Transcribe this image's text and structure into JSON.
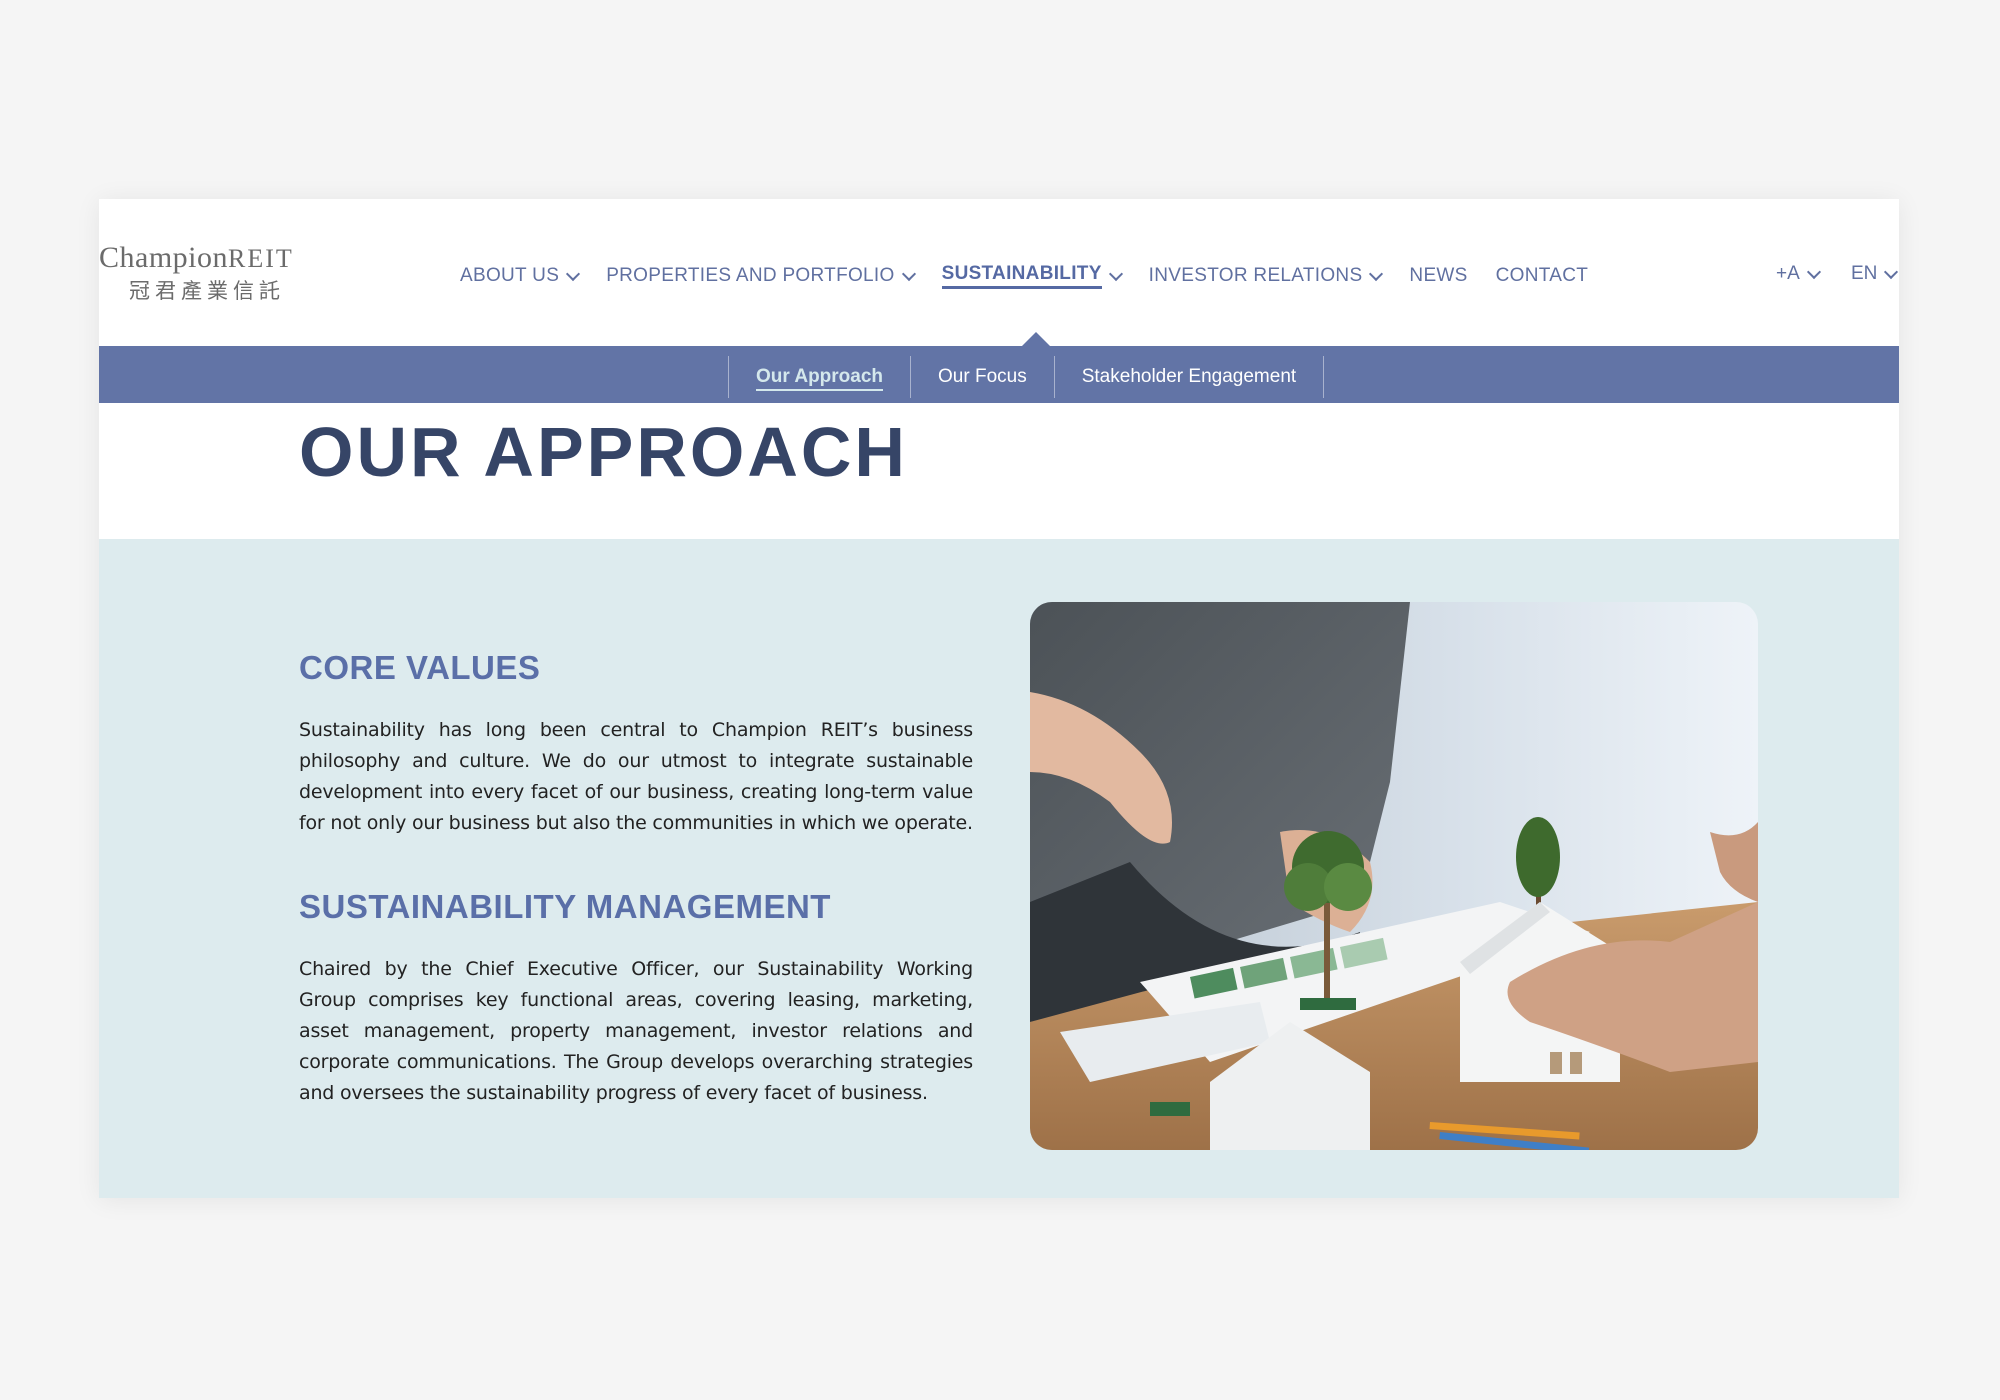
{
  "logo": {
    "name_en": "Champion",
    "name_en_suffix": "REIT",
    "name_zh": "冠君產業信託"
  },
  "nav": {
    "items": [
      {
        "label": "ABOUT US"
      },
      {
        "label": "PROPERTIES AND PORTFOLIO"
      },
      {
        "label": "SUSTAINABILITY"
      },
      {
        "label": "INVESTOR RELATIONS"
      },
      {
        "label": "NEWS"
      },
      {
        "label": "CONTACT"
      }
    ],
    "active": "SUSTAINABILITY"
  },
  "utility": {
    "font_size_label": "+A",
    "language_label": "EN"
  },
  "subnav": {
    "items": [
      {
        "label": "Our Approach"
      },
      {
        "label": "Our Focus"
      },
      {
        "label": "Stakeholder Engagement"
      }
    ],
    "active": "Our Approach"
  },
  "page": {
    "title": "OUR APPROACH"
  },
  "sections": [
    {
      "heading": "CORE VALUES",
      "body": "Sustainability has long been central to Champion REIT’s business philosophy and culture. We do our utmost to integrate sustainable development into every facet of our business, creating long-term value for not only our business but also the communities in which we operate."
    },
    {
      "heading": "SUSTAINABILITY MANAGEMENT",
      "body": "Chaired by the Chief Executive Officer, our Sustainability Working Group comprises key functional areas, covering leasing, marketing, asset management, property management, investor relations and corporate communications. The Group develops overarching strategies and oversees the sustainability progress of every facet of business."
    }
  ],
  "colors": {
    "accent": "#5a6fa8",
    "subnav_bg": "#6274a6",
    "title": "#364567",
    "content_bg": "#ddebee",
    "page_bg": "#f5f5f5"
  },
  "image": {
    "subject": "people-with-model-trees-and-houses"
  }
}
